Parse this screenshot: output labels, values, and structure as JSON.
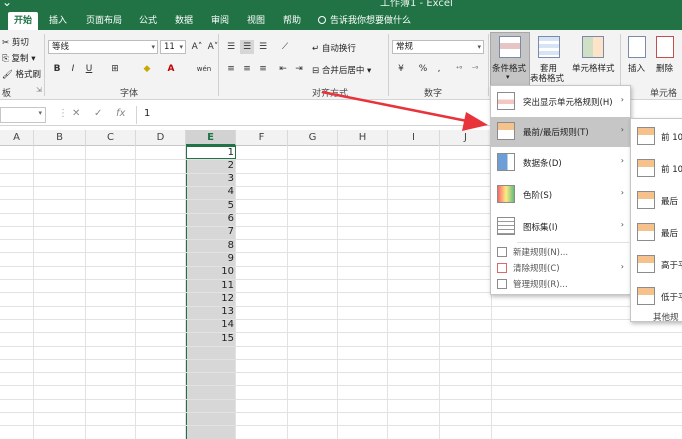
{
  "app": {
    "title_fragment": "工作簿1 - Excel",
    "accent": "#217346"
  },
  "tabs": [
    {
      "label": "开始",
      "active": true
    },
    {
      "label": "插入"
    },
    {
      "label": "页面布局"
    },
    {
      "label": "公式"
    },
    {
      "label": "数据"
    },
    {
      "label": "审阅"
    },
    {
      "label": "视图"
    },
    {
      "label": "帮助"
    }
  ],
  "tell_me": "告诉我你想要做什么",
  "ribbon": {
    "clipboard": {
      "cut": "剪切",
      "copy": "复制",
      "format_painter": "格式刷",
      "label": "板"
    },
    "font": {
      "name": "等线",
      "size": "11",
      "grow": "A˄",
      "shrink": "A˅",
      "bold": "B",
      "italic": "I",
      "underline": "U",
      "wen": "wén",
      "label": "字体"
    },
    "alignment": {
      "wrap": "自动换行",
      "merge": "合并后居中",
      "label": "对齐方式"
    },
    "number": {
      "format": "常规",
      "percent": "%",
      "comma": ",",
      "label": "数字"
    },
    "styles": {
      "conditional": "条件格式",
      "table1": "套用",
      "table2": "表格格式",
      "cell_styles": "单元格样式"
    },
    "cells": {
      "insert": "插入",
      "delete": "删除",
      "label": "单元格"
    }
  },
  "formula_bar": {
    "name_box": "",
    "value": "1",
    "cancel": "✕",
    "enter": "✓",
    "fx": "fx"
  },
  "columns": [
    "A",
    "B",
    "C",
    "D",
    "E",
    "F",
    "G",
    "H",
    "I",
    "J"
  ],
  "selected_column": "E",
  "cell_values": [
    "1",
    "2",
    "3",
    "4",
    "5",
    "6",
    "7",
    "8",
    "9",
    "10",
    "11",
    "12",
    "13",
    "14",
    "15"
  ],
  "menu": {
    "items": [
      {
        "label": "突出显示单元格规则(H)",
        "arrow": "›"
      },
      {
        "label": "最前/最后规则(T)",
        "arrow": "›"
      },
      {
        "label": "数据条(D)",
        "arrow": "›"
      },
      {
        "label": "色阶(S)",
        "arrow": "›"
      },
      {
        "label": "图标集(I)",
        "arrow": "›"
      },
      {
        "label": "新建规则(N)..."
      },
      {
        "label": "清除规则(C)",
        "arrow": "›"
      },
      {
        "label": "管理规则(R)..."
      }
    ]
  },
  "submenu": {
    "items": [
      {
        "label": "前 10"
      },
      {
        "label": "前 10"
      },
      {
        "label": "最后"
      },
      {
        "label": "最后"
      },
      {
        "label": "高于平"
      },
      {
        "label": "低于平"
      },
      {
        "label": "其他规"
      }
    ]
  }
}
